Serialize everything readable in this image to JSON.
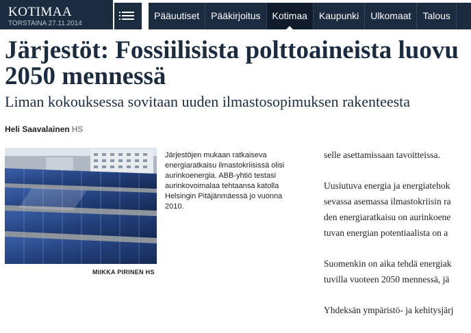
{
  "section": {
    "title": "KOTIMAA",
    "date": "TORSTAINA 27.11.2014"
  },
  "nav": {
    "items": [
      "Pääuutiset",
      "Pääkirjoitus",
      "Kotimaa",
      "Kaupunki",
      "Ulkomaat",
      "Talous"
    ],
    "active": "Kotimaa"
  },
  "article": {
    "headline_line1": "Järjestöt: Fossiilisista polttoaineista luovu",
    "headline_line2": "2050 mennessä",
    "subheadline": "Liman kokouksessa sovitaan uuden ilmastosopimuksen rakenteesta",
    "author": "Heli Saavalainen",
    "paper": "HS",
    "photo_caption": "Järjestöjen mukaan ratkaiseva energiaratkaisu ilmastokriisissä olisi aurinkoenergia. ABB-yhtiö testasi aurinkovoimalaa tehtaansa katolla Helsingin Pitäjänmäessä jo vuonna 2010.",
    "photo_credit": "MIIKKA PIRINEN HS",
    "body_lines": [
      [
        "selle asettamissaan tavoitteissa."
      ],
      [
        "Uusiutuva energia ja energiatehok",
        "sevassa asemassa ilmastokriisin ra",
        "den energiaratkaisu on aurinkoene",
        "tuvan energian potentiaalista on a"
      ],
      [
        "Suomenkin on aika tehdä energiak",
        "tuvilla vuoteen 2050 mennessä, jä"
      ],
      [
        "Yhdeksän ympäristö- ja kehitysjärj"
      ]
    ]
  }
}
